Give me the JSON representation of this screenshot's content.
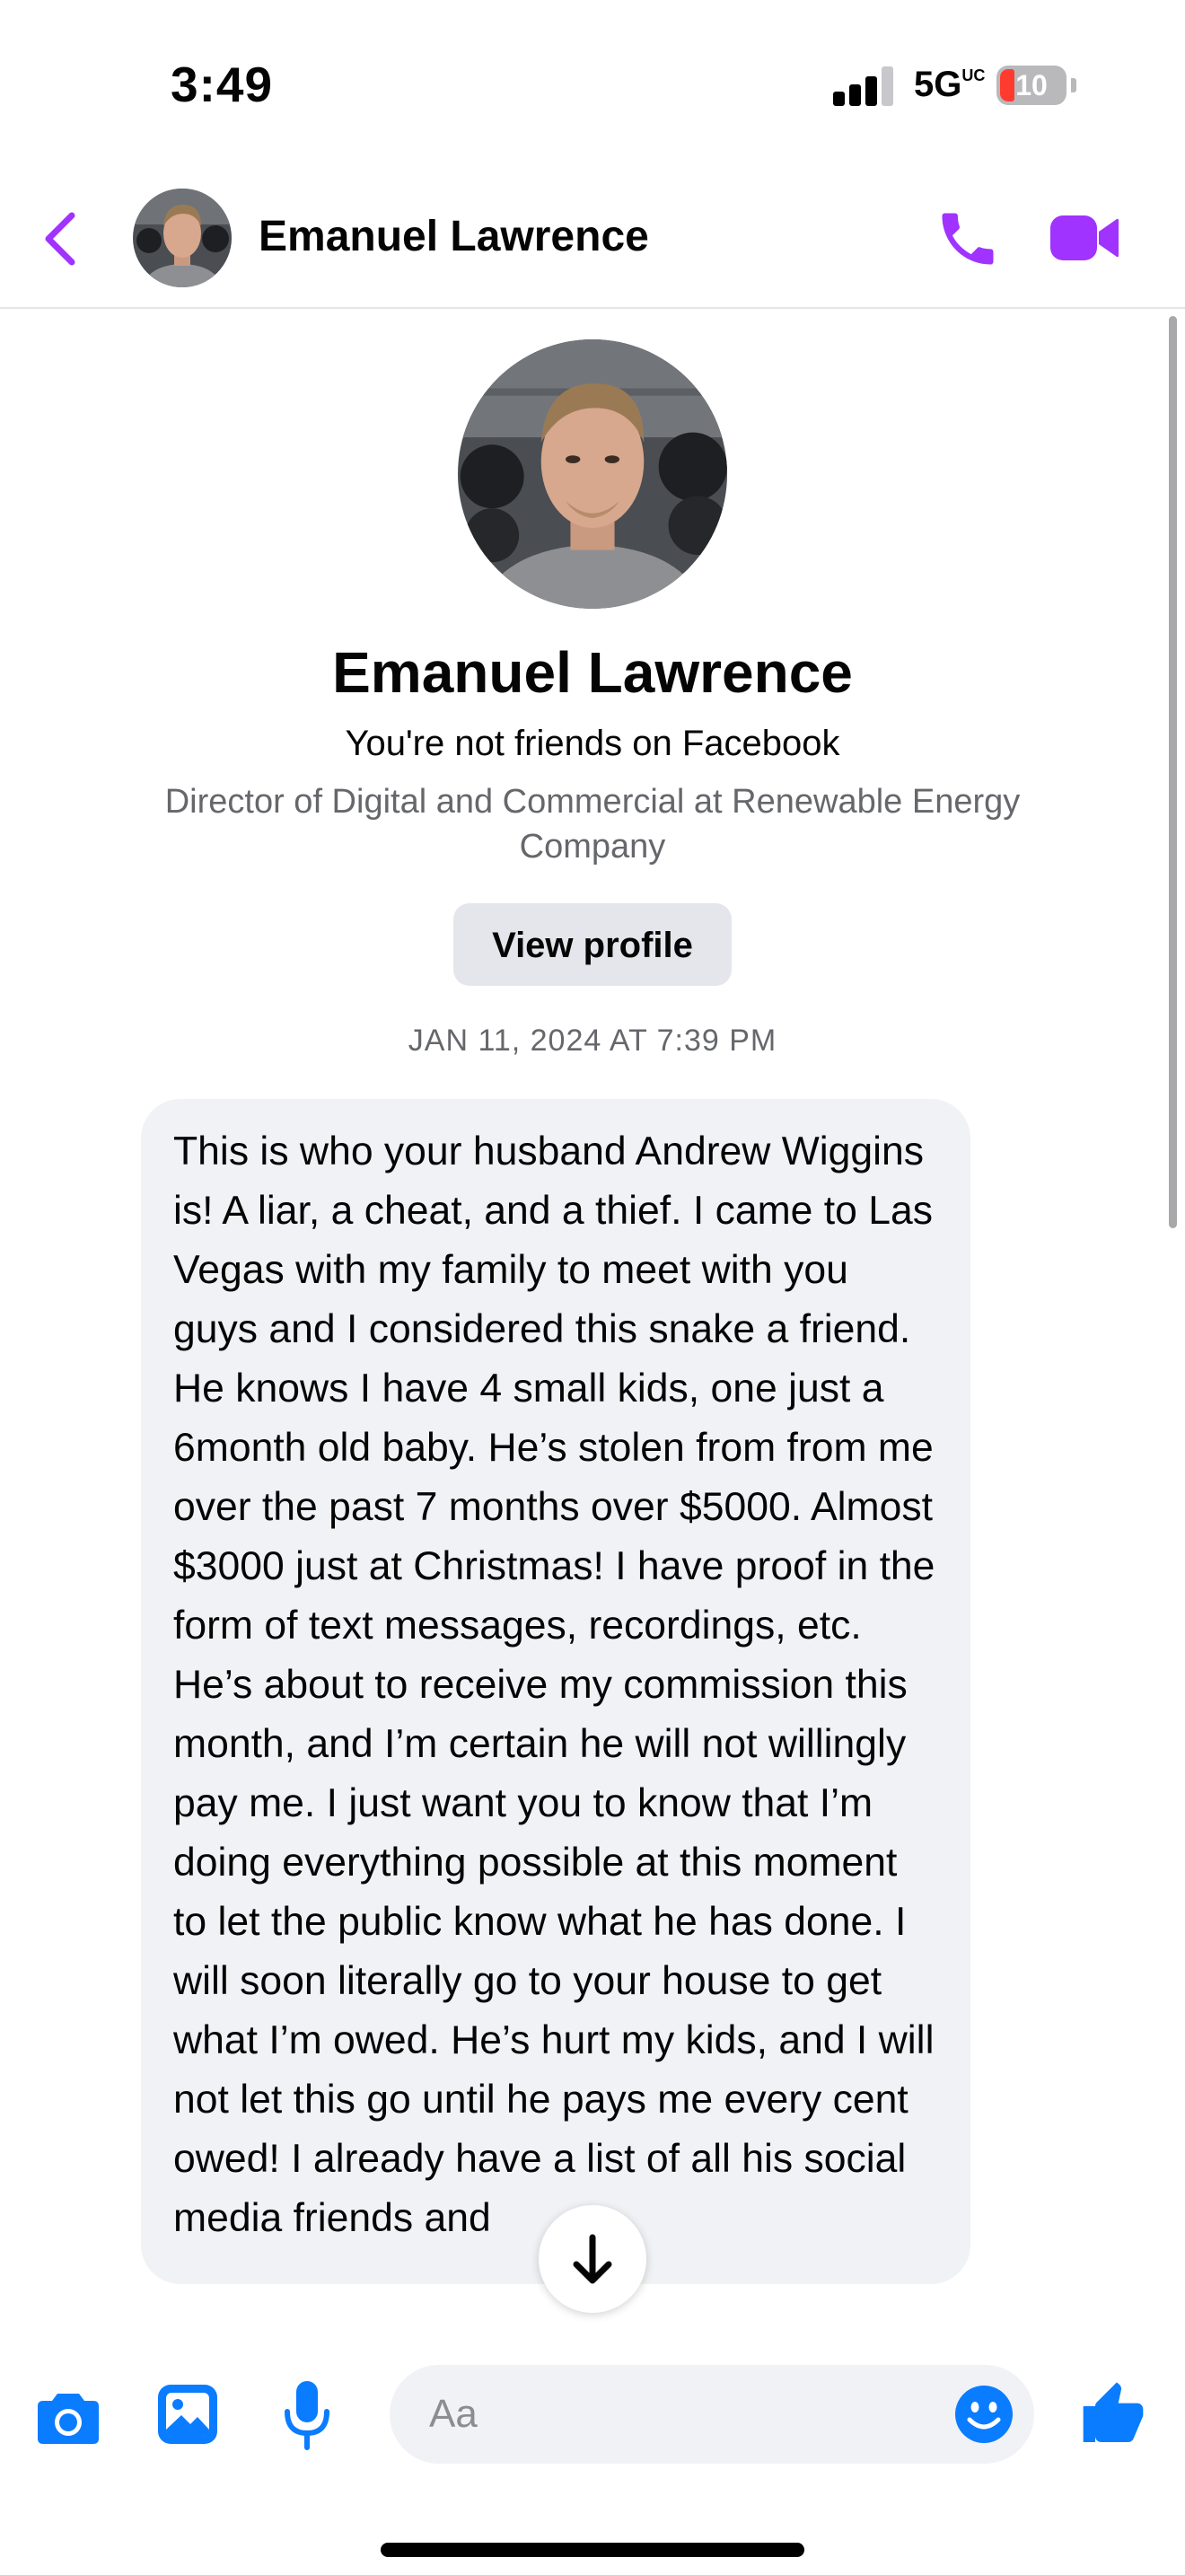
{
  "status_bar": {
    "time": "3:49",
    "network": "5G",
    "network_suffix": "UC",
    "battery": "10"
  },
  "header": {
    "contact_name": "Emanuel Lawrence"
  },
  "profile": {
    "name": "Emanuel Lawrence",
    "friend_status": "You're not friends on Facebook",
    "job_title": "Director of Digital and Commercial at Renewable Energy Company",
    "view_profile_label": "View profile"
  },
  "conversation": {
    "timestamp": "JAN 11, 2024 AT 7:39 PM",
    "messages": [
      {
        "text": "This is who your husband Andrew Wiggins is! A liar, a cheat, and a thief. I came to Las Vegas with my family to meet with you guys and I considered this snake a friend. He knows I have 4 small kids, one just a 6month old baby. He’s stolen from from me over the past 7 months over $5000. Almost $3000 just at Christmas! I have proof in the form of text messages, recordings, etc. He’s about to receive my commission this month, and I’m certain he will not willingly pay me. I just want you to know that I’m doing everything possible at this moment to let the public know what he has done. I will soon literally go to your house to get what I’m owed. He’s hurt my kids, and I will not let this go until he pays me every cent owed! I already have a list of all his social media friends and"
      }
    ]
  },
  "composer": {
    "placeholder": "Aa"
  },
  "colors": {
    "accent_purple": "#a033ff",
    "messenger_blue": "#0a7cff",
    "bubble_gray": "#f0f2f5",
    "secondary_text": "#65676b"
  },
  "icons": {
    "back": "chevron-left-icon",
    "call": "phone-icon",
    "video": "video-camera-icon",
    "scroll_down": "arrow-down-icon",
    "camera": "camera-icon",
    "gallery": "photo-gallery-icon",
    "mic": "microphone-icon",
    "emoji": "smiley-icon",
    "like": "thumbs-up-icon"
  }
}
